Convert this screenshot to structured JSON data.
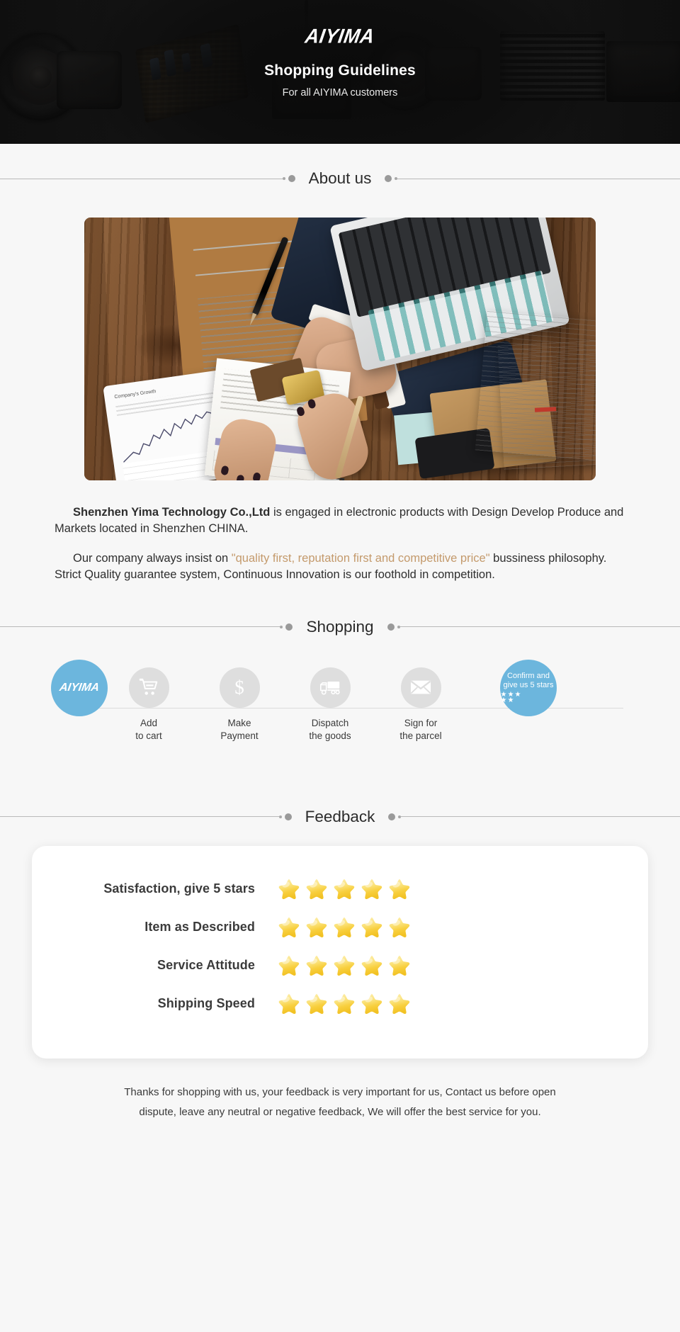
{
  "hero": {
    "brand": "AIYIMA",
    "title": "Shopping Guidelines",
    "subtitle": "For all AIYIMA customers"
  },
  "sections": {
    "about_title": "About us",
    "shopping_title": "Shopping",
    "feedback_title": "Feedback"
  },
  "about": {
    "paragraph1_bold": "Shenzhen Yima Technology Co.,Ltd",
    "paragraph1_rest": " is engaged in electronic products with Design Develop Produce and Markets located in Shenzhen CHINA.",
    "paragraph2_before": "Our company always insist on ",
    "paragraph2_quote": "\"quality first, reputation first and competitive price\"",
    "paragraph2_after": " bussiness philosophy. Strict Quality guarantee system, Continuous Innovation is our foothold in competition."
  },
  "shopping": {
    "steps": [
      {
        "icon": "aiyima-logo-icon",
        "brand": "AIYIMA",
        "label_line1": "",
        "label_line2": ""
      },
      {
        "icon": "shopping-cart-icon",
        "label_line1": "Add",
        "label_line2": "to cart"
      },
      {
        "icon": "dollar-sign-icon",
        "label_line1": "Make",
        "label_line2": "Payment"
      },
      {
        "icon": "delivery-truck-icon",
        "label_line1": "Dispatch",
        "label_line2": "the goods"
      },
      {
        "icon": "envelope-icon",
        "label_line1": "Sign for",
        "label_line2": "the parcel"
      },
      {
        "icon": "five-stars-icon",
        "text_line1": "Confirm and",
        "text_line2": "give us 5 stars",
        "stars_row1": "★★★",
        "stars_row2": "★★"
      }
    ]
  },
  "feedback": {
    "rows": [
      {
        "label": "Satisfaction, give 5 stars",
        "stars": 5
      },
      {
        "label": "Item as Described",
        "stars": 5
      },
      {
        "label": "Service Attitude",
        "stars": 5
      },
      {
        "label": "Shipping Speed",
        "stars": 5
      }
    ]
  },
  "footer": {
    "line1": "Thanks for shopping with us, your feedback is very important for us, Contact us before open",
    "line2": "dispute, leave any neutral or negative feedback, We will offer the best service for you."
  },
  "colors": {
    "accent_blue": "#6cb6dd",
    "hero_bg": "#141414",
    "page_bg": "#f7f7f7",
    "quote_brown": "#c49a6c",
    "star_gold": "#f7d34e",
    "inactive_circle": "#dedede"
  }
}
